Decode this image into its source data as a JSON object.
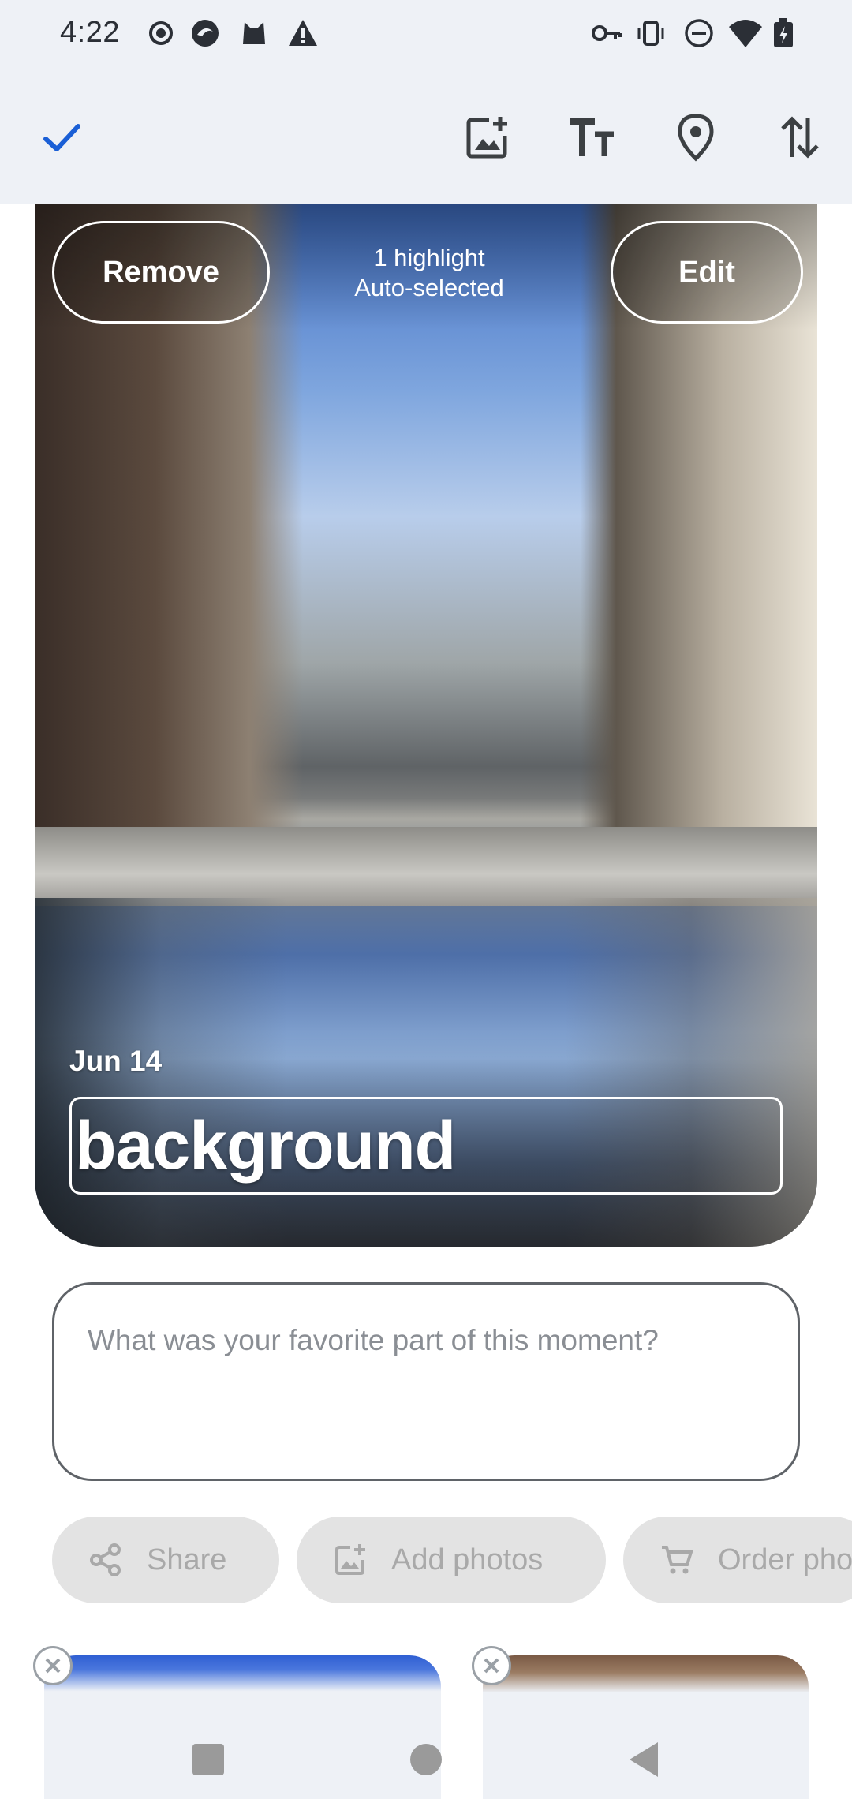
{
  "status_bar": {
    "time": "4:22",
    "icons_left": [
      "record-icon",
      "app-icon",
      "cat-icon",
      "warning-icon"
    ],
    "icons_right": [
      "key-icon",
      "vibrate-icon",
      "do-not-disturb-icon",
      "wifi-icon",
      "battery-icon"
    ]
  },
  "toolbar": {
    "done": "check-icon",
    "actions": [
      "add-photo-icon",
      "text-size-icon",
      "location-icon",
      "swap-vertical-icon"
    ],
    "accent_color": "#1a5fd6"
  },
  "card": {
    "remove_label": "Remove",
    "edit_label": "Edit",
    "highlight_line1": "1 highlight",
    "highlight_line2": "Auto-selected",
    "date": "Jun 14",
    "title": "background"
  },
  "comment": {
    "placeholder": "What was your favorite part of this moment?"
  },
  "chips": {
    "share": "Share",
    "add_photos": "Add photos",
    "order": "Order pho"
  },
  "navbar": {
    "items": [
      "recents-icon",
      "home-icon",
      "back-icon"
    ]
  }
}
